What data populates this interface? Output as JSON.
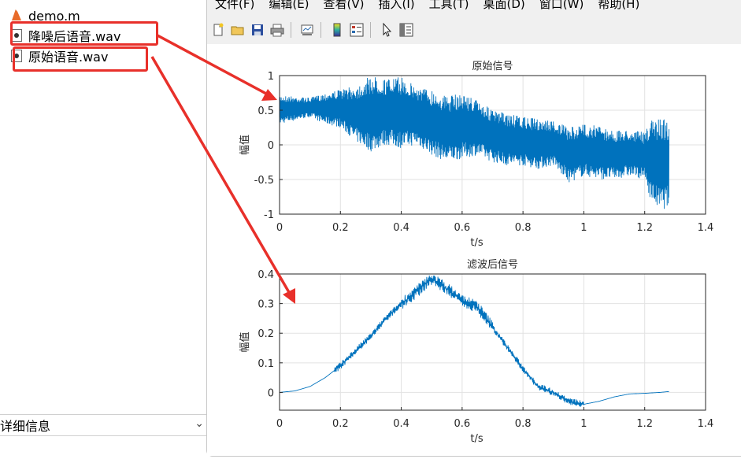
{
  "browser": {
    "files": [
      {
        "name": "demo.m",
        "type": "m"
      },
      {
        "name": "降噪后语音.wav",
        "type": "wav"
      },
      {
        "name": "原始语音.wav",
        "type": "wav"
      }
    ],
    "details_label": "详细信息"
  },
  "figure": {
    "menu": [
      "文件(F)",
      "编辑(E)",
      "查看(V)",
      "插入(I)",
      "工具(T)",
      "桌面(D)",
      "窗口(W)",
      "帮助(H)"
    ],
    "toolbar_icons": [
      "new-figure-icon",
      "open-file-icon",
      "save-icon",
      "print-icon",
      "link-plot-icon",
      "colorbar-icon",
      "legend-icon",
      "pointer-icon",
      "property-editor-icon"
    ]
  },
  "chart_data": [
    {
      "type": "line",
      "title": "原始信号",
      "xlabel": "t/s",
      "ylabel": "幅值",
      "xlim": [
        0,
        1.4
      ],
      "ylim": [
        -1,
        1
      ],
      "xticks": [
        "0",
        "0.2",
        "0.4",
        "0.6",
        "0.8",
        "1",
        "1.2",
        "1.4"
      ],
      "yticks": [
        "-1",
        "-0.5",
        "0",
        "0.5",
        "1"
      ],
      "grid": true,
      "color": "#0072BD",
      "envelope": {
        "t": [
          0,
          0.05,
          0.1,
          0.15,
          0.2,
          0.25,
          0.3,
          0.35,
          0.4,
          0.45,
          0.5,
          0.55,
          0.6,
          0.65,
          0.7,
          0.75,
          0.8,
          0.85,
          0.9,
          0.95,
          1.0,
          1.05,
          1.1,
          1.15,
          1.2,
          1.22,
          1.25,
          1.28
        ],
        "upper": [
          0.72,
          0.7,
          0.68,
          0.75,
          0.8,
          0.85,
          1.0,
          0.95,
          0.98,
          0.85,
          0.8,
          0.7,
          0.75,
          0.65,
          0.5,
          0.45,
          0.4,
          0.38,
          0.35,
          0.25,
          0.3,
          0.28,
          0.2,
          0.22,
          0.18,
          0.35,
          0.4,
          0.38
        ],
        "lower": [
          0.3,
          0.35,
          0.4,
          0.3,
          0.25,
          0.05,
          -0.1,
          0.0,
          -0.05,
          0.0,
          -0.15,
          -0.25,
          -0.2,
          -0.15,
          -0.25,
          -0.3,
          -0.3,
          -0.35,
          -0.3,
          -0.55,
          -0.45,
          -0.5,
          -0.5,
          -0.45,
          -0.5,
          -0.8,
          -0.95,
          -0.9
        ]
      }
    },
    {
      "type": "line",
      "title": "滤波后信号",
      "xlabel": "t/s",
      "ylabel": "幅值",
      "xlim": [
        0,
        1.4
      ],
      "ylim": [
        -0.06,
        0.4
      ],
      "xticks": [
        "0",
        "0.2",
        "0.4",
        "0.6",
        "0.8",
        "1",
        "1.2",
        "1.4"
      ],
      "yticks": [
        "0",
        "0.1",
        "0.2",
        "0.3",
        "0.4"
      ],
      "grid": true,
      "color": "#0072BD",
      "t": [
        0,
        0.05,
        0.1,
        0.15,
        0.2,
        0.25,
        0.3,
        0.35,
        0.4,
        0.45,
        0.5,
        0.55,
        0.6,
        0.65,
        0.7,
        0.75,
        0.8,
        0.85,
        0.9,
        0.95,
        1.0,
        1.05,
        1.1,
        1.15,
        1.2,
        1.25,
        1.28
      ],
      "y": [
        0,
        0.005,
        0.02,
        0.05,
        0.09,
        0.14,
        0.19,
        0.25,
        0.3,
        0.34,
        0.385,
        0.35,
        0.31,
        0.29,
        0.22,
        0.15,
        0.08,
        0.02,
        0.0,
        -0.03,
        -0.04,
        -0.03,
        -0.015,
        -0.005,
        -0.003,
        0.0,
        0.003
      ]
    }
  ]
}
